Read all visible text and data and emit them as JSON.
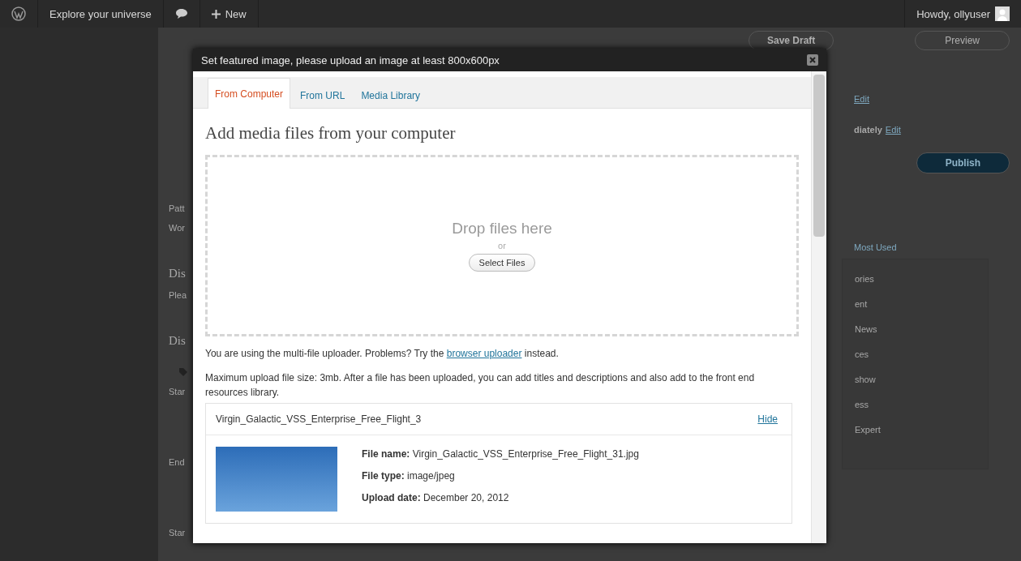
{
  "admin_bar": {
    "site_name": "Explore your universe",
    "new_label": "New",
    "greeting": "Howdy, ollyuser"
  },
  "background": {
    "left_labels": [
      {
        "kind": "label",
        "text": "Patt"
      },
      {
        "kind": "label",
        "text": "Wor"
      },
      {
        "kind": "heading",
        "text": "Dis"
      },
      {
        "kind": "label",
        "text": "Plea"
      },
      {
        "kind": "heading",
        "text": "Dis"
      },
      {
        "kind": "tag"
      },
      {
        "kind": "label",
        "text": "Star"
      },
      {
        "kind": "gap",
        "text": "End"
      },
      {
        "kind": "gap",
        "text": "Star"
      }
    ],
    "save_draft": "Save Draft",
    "preview": "Preview",
    "edit_link": "Edit",
    "schedule_text": "diately",
    "schedule_link": "Edit",
    "publish": "Publish",
    "categories_tab": "Most Used",
    "category_items": [
      "ories",
      "ent",
      "News",
      "ces",
      "show",
      "ess",
      "Expert"
    ]
  },
  "modal": {
    "title": "Set featured image, please upload an image at least 800x600px",
    "tabs": [
      {
        "label": "From Computer",
        "selected": true
      },
      {
        "label": "From URL",
        "selected": false
      },
      {
        "label": "Media Library",
        "selected": false
      }
    ],
    "heading": "Add media files from your computer",
    "drop_text": "Drop files here",
    "or_text": "or",
    "select_button": "Select Files",
    "uploader_note": {
      "before": "You are using the multi-file uploader. Problems? Try the",
      "link": "browser uploader",
      "after": "instead."
    },
    "size_note": "Maximum upload file size: 3mb. After a file has been uploaded, you can add titles and descriptions and also add to the front end resources library.",
    "file": {
      "title": "Virgin_Galactic_VSS_Enterprise_Free_Flight_3",
      "hide": "Hide",
      "details": [
        "**File name:** Virgin_Galactic_VSS_Enterprise_Free_Flight_31.jpg",
        "**File type:** image/jpeg",
        "**Upload date:** December 20, 2012"
      ]
    }
  }
}
